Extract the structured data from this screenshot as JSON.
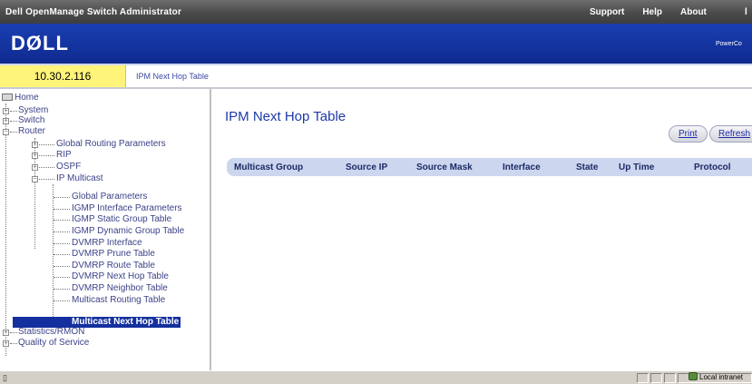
{
  "topbar": {
    "title": "Dell OpenManage Switch Administrator",
    "links": [
      "Support",
      "Help",
      "About"
    ],
    "trailing": "l"
  },
  "banner": {
    "logo": "DØLL",
    "product": "PowerCo"
  },
  "address": {
    "ip": "10.30.2.116",
    "breadcrumb": "IPM Next Hop Table"
  },
  "tree": {
    "home": "Home",
    "system": "System",
    "switch": "Switch",
    "router": "Router",
    "global_routing": "Global Routing Parameters",
    "rip": "RIP",
    "ospf": "OSPF",
    "ip_multicast": "IP Multicast",
    "mc_items": [
      "Global Parameters",
      "IGMP Interface Parameters",
      "IGMP Static Group Table",
      "IGMP Dynamic Group Table",
      "DVMRP Interface",
      "DVMRP Prune Table",
      "DVMRP Route Table",
      "DVMRP Next Hop Table",
      "DVMRP Neighbor Table",
      "Multicast Routing Table",
      "Multicast Next Hop Table"
    ],
    "statistics": "Statistics/RMON",
    "qos": "Quality of Service"
  },
  "content": {
    "title": "IPM Next Hop Table",
    "print_label": "Print",
    "refresh_label": "Refresh",
    "columns": [
      "Multicast Group",
      "Source IP",
      "Source Mask",
      "Interface",
      "State",
      "Up Time",
      "Protocol"
    ]
  },
  "statusbar": {
    "left_icon": "page-icon",
    "zone": "Local intranet"
  },
  "colors": {
    "banner": "#1a3fb2",
    "ip_highlight": "#fff47a",
    "selected": "#14309e",
    "table_header": "#ccd6ee"
  }
}
